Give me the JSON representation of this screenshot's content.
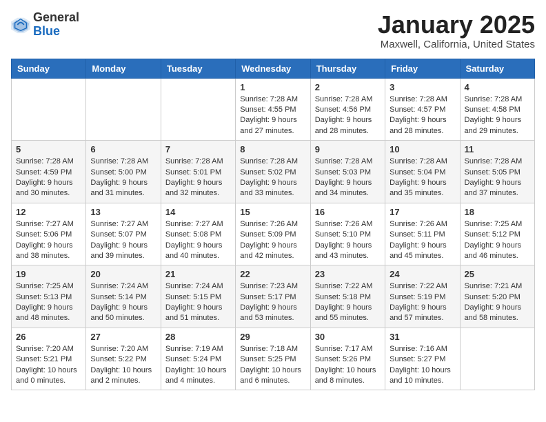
{
  "logo": {
    "general": "General",
    "blue": "Blue"
  },
  "header": {
    "month": "January 2025",
    "location": "Maxwell, California, United States"
  },
  "weekdays": [
    "Sunday",
    "Monday",
    "Tuesday",
    "Wednesday",
    "Thursday",
    "Friday",
    "Saturday"
  ],
  "weeks": [
    [
      {
        "day": "",
        "content": ""
      },
      {
        "day": "",
        "content": ""
      },
      {
        "day": "",
        "content": ""
      },
      {
        "day": "1",
        "content": "Sunrise: 7:28 AM\nSunset: 4:55 PM\nDaylight: 9 hours\nand 27 minutes."
      },
      {
        "day": "2",
        "content": "Sunrise: 7:28 AM\nSunset: 4:56 PM\nDaylight: 9 hours\nand 28 minutes."
      },
      {
        "day": "3",
        "content": "Sunrise: 7:28 AM\nSunset: 4:57 PM\nDaylight: 9 hours\nand 28 minutes."
      },
      {
        "day": "4",
        "content": "Sunrise: 7:28 AM\nSunset: 4:58 PM\nDaylight: 9 hours\nand 29 minutes."
      }
    ],
    [
      {
        "day": "5",
        "content": "Sunrise: 7:28 AM\nSunset: 4:59 PM\nDaylight: 9 hours\nand 30 minutes."
      },
      {
        "day": "6",
        "content": "Sunrise: 7:28 AM\nSunset: 5:00 PM\nDaylight: 9 hours\nand 31 minutes."
      },
      {
        "day": "7",
        "content": "Sunrise: 7:28 AM\nSunset: 5:01 PM\nDaylight: 9 hours\nand 32 minutes."
      },
      {
        "day": "8",
        "content": "Sunrise: 7:28 AM\nSunset: 5:02 PM\nDaylight: 9 hours\nand 33 minutes."
      },
      {
        "day": "9",
        "content": "Sunrise: 7:28 AM\nSunset: 5:03 PM\nDaylight: 9 hours\nand 34 minutes."
      },
      {
        "day": "10",
        "content": "Sunrise: 7:28 AM\nSunset: 5:04 PM\nDaylight: 9 hours\nand 35 minutes."
      },
      {
        "day": "11",
        "content": "Sunrise: 7:28 AM\nSunset: 5:05 PM\nDaylight: 9 hours\nand 37 minutes."
      }
    ],
    [
      {
        "day": "12",
        "content": "Sunrise: 7:27 AM\nSunset: 5:06 PM\nDaylight: 9 hours\nand 38 minutes."
      },
      {
        "day": "13",
        "content": "Sunrise: 7:27 AM\nSunset: 5:07 PM\nDaylight: 9 hours\nand 39 minutes."
      },
      {
        "day": "14",
        "content": "Sunrise: 7:27 AM\nSunset: 5:08 PM\nDaylight: 9 hours\nand 40 minutes."
      },
      {
        "day": "15",
        "content": "Sunrise: 7:26 AM\nSunset: 5:09 PM\nDaylight: 9 hours\nand 42 minutes."
      },
      {
        "day": "16",
        "content": "Sunrise: 7:26 AM\nSunset: 5:10 PM\nDaylight: 9 hours\nand 43 minutes."
      },
      {
        "day": "17",
        "content": "Sunrise: 7:26 AM\nSunset: 5:11 PM\nDaylight: 9 hours\nand 45 minutes."
      },
      {
        "day": "18",
        "content": "Sunrise: 7:25 AM\nSunset: 5:12 PM\nDaylight: 9 hours\nand 46 minutes."
      }
    ],
    [
      {
        "day": "19",
        "content": "Sunrise: 7:25 AM\nSunset: 5:13 PM\nDaylight: 9 hours\nand 48 minutes."
      },
      {
        "day": "20",
        "content": "Sunrise: 7:24 AM\nSunset: 5:14 PM\nDaylight: 9 hours\nand 50 minutes."
      },
      {
        "day": "21",
        "content": "Sunrise: 7:24 AM\nSunset: 5:15 PM\nDaylight: 9 hours\nand 51 minutes."
      },
      {
        "day": "22",
        "content": "Sunrise: 7:23 AM\nSunset: 5:17 PM\nDaylight: 9 hours\nand 53 minutes."
      },
      {
        "day": "23",
        "content": "Sunrise: 7:22 AM\nSunset: 5:18 PM\nDaylight: 9 hours\nand 55 minutes."
      },
      {
        "day": "24",
        "content": "Sunrise: 7:22 AM\nSunset: 5:19 PM\nDaylight: 9 hours\nand 57 minutes."
      },
      {
        "day": "25",
        "content": "Sunrise: 7:21 AM\nSunset: 5:20 PM\nDaylight: 9 hours\nand 58 minutes."
      }
    ],
    [
      {
        "day": "26",
        "content": "Sunrise: 7:20 AM\nSunset: 5:21 PM\nDaylight: 10 hours\nand 0 minutes."
      },
      {
        "day": "27",
        "content": "Sunrise: 7:20 AM\nSunset: 5:22 PM\nDaylight: 10 hours\nand 2 minutes."
      },
      {
        "day": "28",
        "content": "Sunrise: 7:19 AM\nSunset: 5:24 PM\nDaylight: 10 hours\nand 4 minutes."
      },
      {
        "day": "29",
        "content": "Sunrise: 7:18 AM\nSunset: 5:25 PM\nDaylight: 10 hours\nand 6 minutes."
      },
      {
        "day": "30",
        "content": "Sunrise: 7:17 AM\nSunset: 5:26 PM\nDaylight: 10 hours\nand 8 minutes."
      },
      {
        "day": "31",
        "content": "Sunrise: 7:16 AM\nSunset: 5:27 PM\nDaylight: 10 hours\nand 10 minutes."
      },
      {
        "day": "",
        "content": ""
      }
    ]
  ]
}
